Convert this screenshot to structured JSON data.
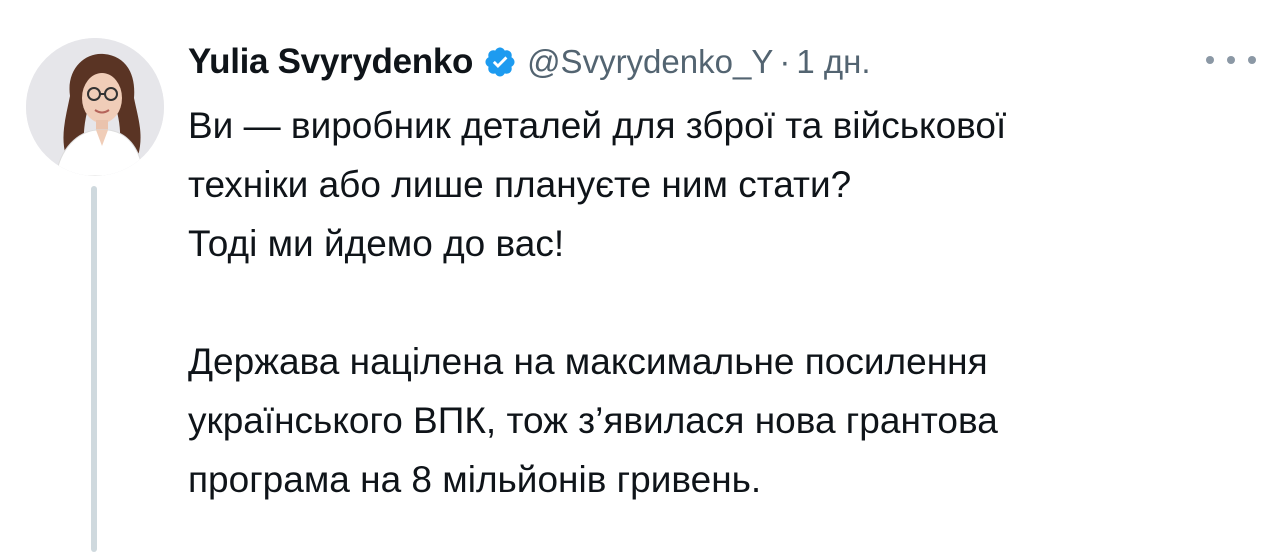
{
  "author": {
    "name": "Yulia Svyrydenko",
    "handle": "@Svyrydenko_Y",
    "separator": "·",
    "time": "1 дн.",
    "verified_icon": "verified-badge-icon",
    "avatar_icon": "profile-photo"
  },
  "tweet": {
    "paragraphs": [
      {
        "lines": [
          "Ви — виробник деталей для зброї та військової",
          "техніки або лише плануєте ним стати?",
          "Тоді ми йдемо до вас!"
        ]
      },
      {
        "lines": [
          "Держава націлена на максимальне посилення",
          "українського ВПК, тож з’явилася нова грантова",
          "програма на 8 мільйонів гривень."
        ]
      }
    ]
  },
  "colors": {
    "text_primary": "#0f1419",
    "text_secondary": "#536471",
    "verified_blue": "#1d9bf0",
    "thread_line": "#cfd9de"
  },
  "more_icon": "more-horizontal-icon"
}
